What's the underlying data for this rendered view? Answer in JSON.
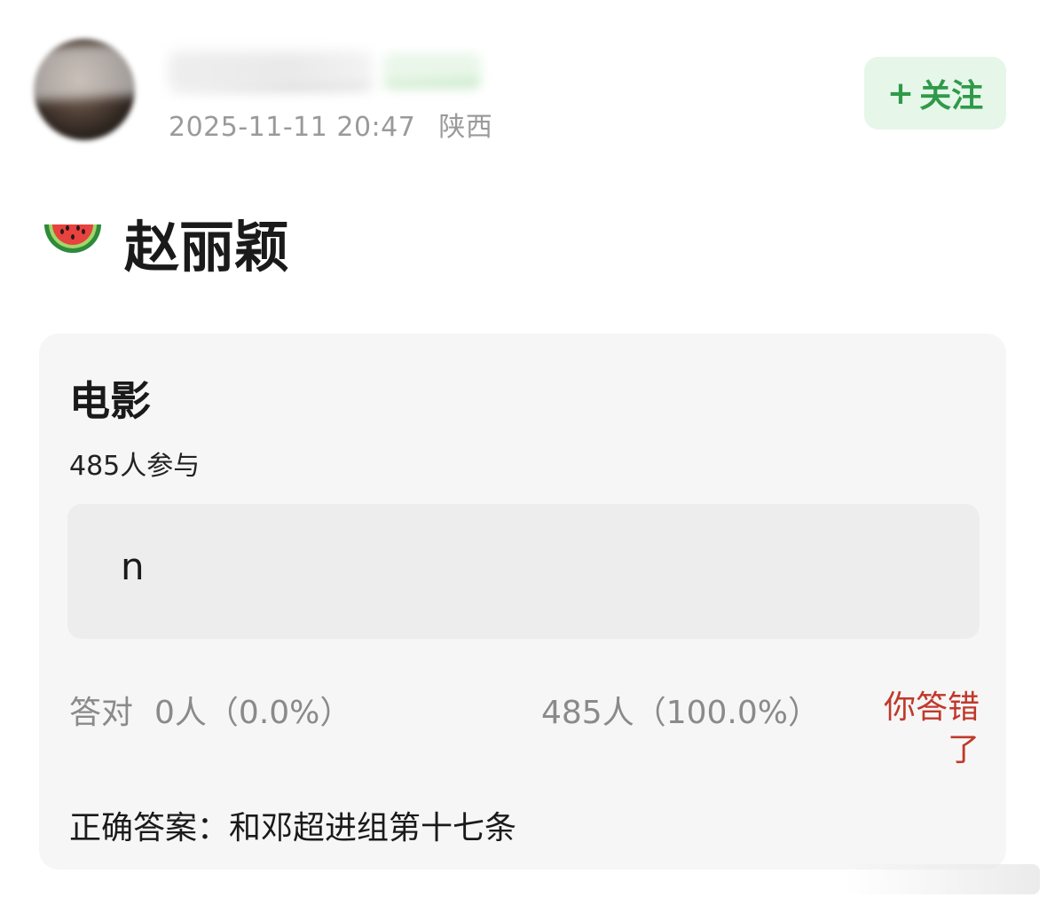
{
  "post": {
    "timestamp": "2025-11-11 20:47",
    "location": "陕西",
    "follow_label": "关注",
    "follow_plus": "+",
    "title": "赵丽颖",
    "title_emoji": "watermelon-icon"
  },
  "quiz": {
    "title": "电影",
    "participants": "485人参与",
    "option_text": "n",
    "correct_label": "答对",
    "correct_stat": "0人（0.0%）",
    "wrong_stat": "485人（100.0%）",
    "verdict": "你答错了",
    "answer_text": "正确答案：和邓超进组第十七条"
  },
  "colors": {
    "accent_green": "#2e9a49",
    "follow_bg": "#e6f6e9",
    "wrong_red": "#c0392b",
    "card_bg": "#f6f6f6"
  }
}
